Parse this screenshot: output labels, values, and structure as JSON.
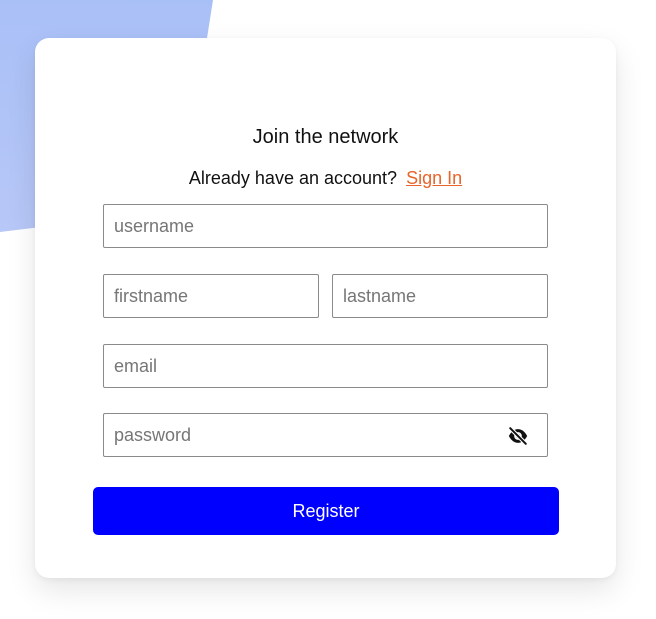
{
  "form": {
    "title": "Join the network",
    "signin_prompt": "Already have an account?",
    "signin_link": "Sign In",
    "username_placeholder": "username",
    "firstname_placeholder": "firstname",
    "lastname_placeholder": "lastname",
    "email_placeholder": "email",
    "password_placeholder": "password",
    "password_toggle_icon": "eye-off-icon",
    "register_label": "Register"
  },
  "colors": {
    "accent_link": "#e8642a",
    "button": "#0000ff",
    "background_shape": "#a9c0f7"
  }
}
